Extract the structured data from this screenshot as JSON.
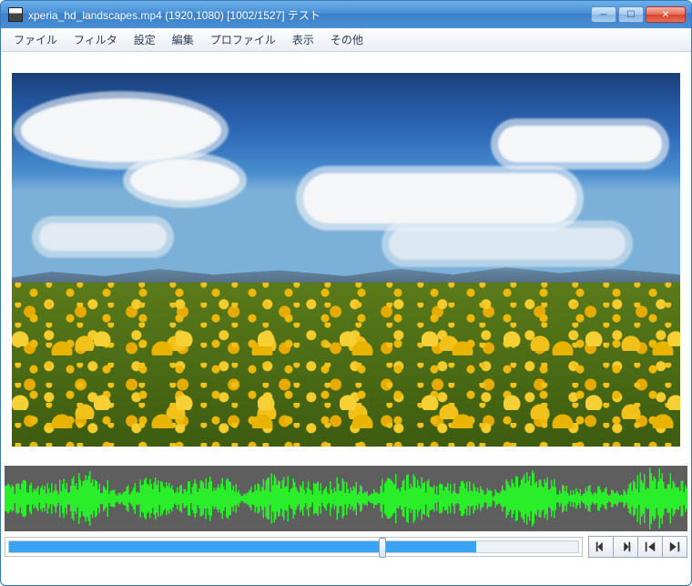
{
  "title": "xperia_hd_landscapes.mp4 (1920,1080)  [1002/1527]  テスト",
  "menu": {
    "file": "ファイル",
    "filter": "フィルタ",
    "settings": "設定",
    "edit": "編集",
    "profile": "プロファイル",
    "view": "表示",
    "other": "その他"
  },
  "playback": {
    "current_frame": 1002,
    "total_frames": 1527,
    "progress_percent": 65.6,
    "seek_end_percent": 82
  },
  "buttons": {
    "step_back": "step-back",
    "step_fwd": "step-forward",
    "go_start": "go-start",
    "go_end": "go-end"
  },
  "window": {
    "minimize": "_",
    "maximize": "□",
    "close": "×"
  }
}
